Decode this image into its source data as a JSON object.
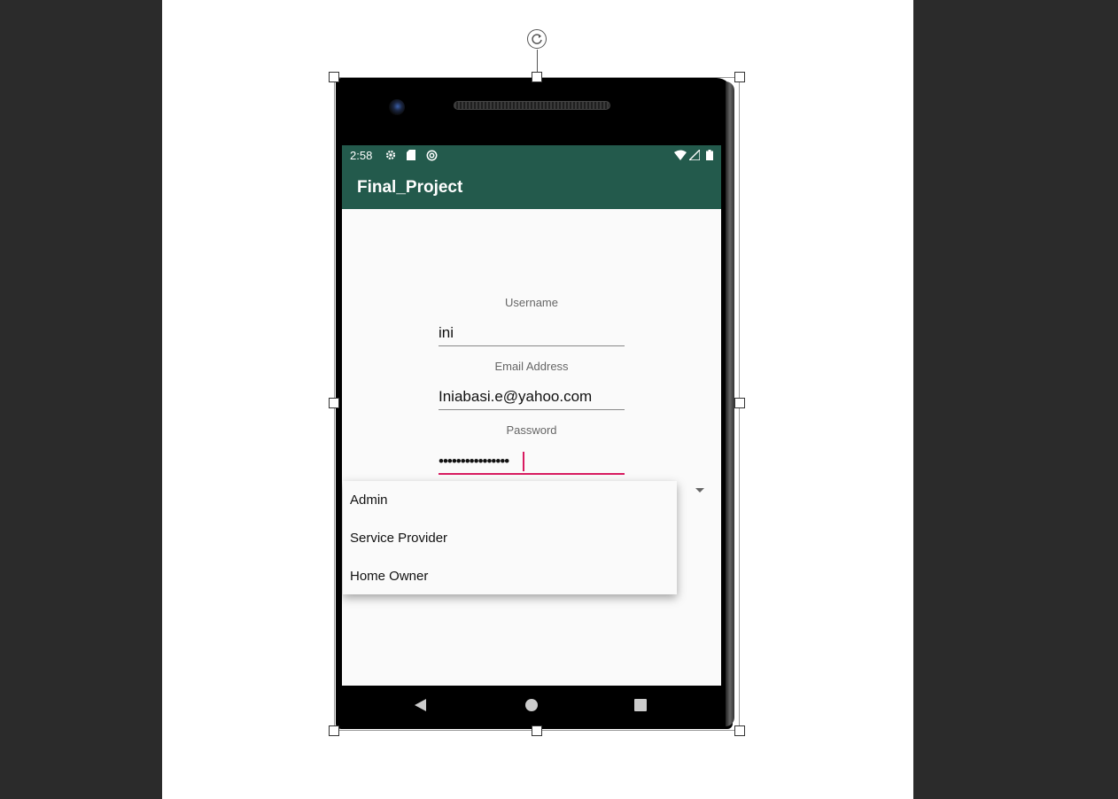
{
  "status_bar": {
    "time": "2:58",
    "left_icons": [
      "gear-icon",
      "sd-card-icon",
      "sync-icon"
    ],
    "right_icons": [
      "wifi-icon",
      "signal-icon",
      "battery-icon"
    ],
    "background": "#235a4c"
  },
  "app_bar": {
    "title": "Final_Project",
    "background": "#235a4c"
  },
  "form": {
    "username_label": "Username",
    "username_value": "ini",
    "email_label": "Email Address",
    "email_value": "Iniabasi.e@yahoo.com",
    "password_label": "Password",
    "password_value": "••••••••••••••••"
  },
  "role_spinner": {
    "options": [
      "Admin",
      "Service Provider",
      "Home Owner"
    ]
  },
  "colors": {
    "accent": "#d81b60",
    "primary": "#235a4c"
  }
}
